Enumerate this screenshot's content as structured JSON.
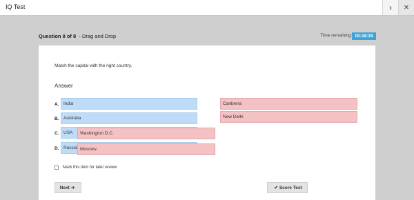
{
  "app": {
    "title": "IQ Test"
  },
  "nav": {
    "next_icon": "chevron-right-icon",
    "close_icon": "close-icon",
    "next_glyph": "›",
    "close_glyph": "✕"
  },
  "question": {
    "number_text": "Question 8 of 8",
    "type_text": "- Drag and Drop",
    "instruction": "Match the capital with the right country.",
    "answer_label": "Answer"
  },
  "timer": {
    "label": "Time remaining:",
    "value": "00:28:29",
    "color": "#3ea4d8"
  },
  "rows": [
    {
      "letter": "A.",
      "country": "India"
    },
    {
      "letter": "B.",
      "country": "Australia"
    },
    {
      "letter": "C.",
      "country": "USA"
    },
    {
      "letter": "D.",
      "country": "Russia"
    }
  ],
  "placed_capitals": [
    {
      "text": "Washington D.C.",
      "row_letter": "C."
    },
    {
      "text": "Moscow",
      "row_letter": "D."
    }
  ],
  "capital_pool": [
    "Canberra",
    "New Delhi"
  ],
  "review": {
    "label": "Mark this item for later review",
    "checked": false
  },
  "buttons": {
    "next_label": "Next",
    "next_icon": "arrow-right-icon",
    "next_glyph": "➔",
    "score_label": "Score Test",
    "score_icon": "check-icon",
    "score_glyph": "✔"
  },
  "colors": {
    "country_fill": "#bedcf8",
    "capital_fill": "#f4c2c4",
    "background": "#cfcfcf"
  }
}
